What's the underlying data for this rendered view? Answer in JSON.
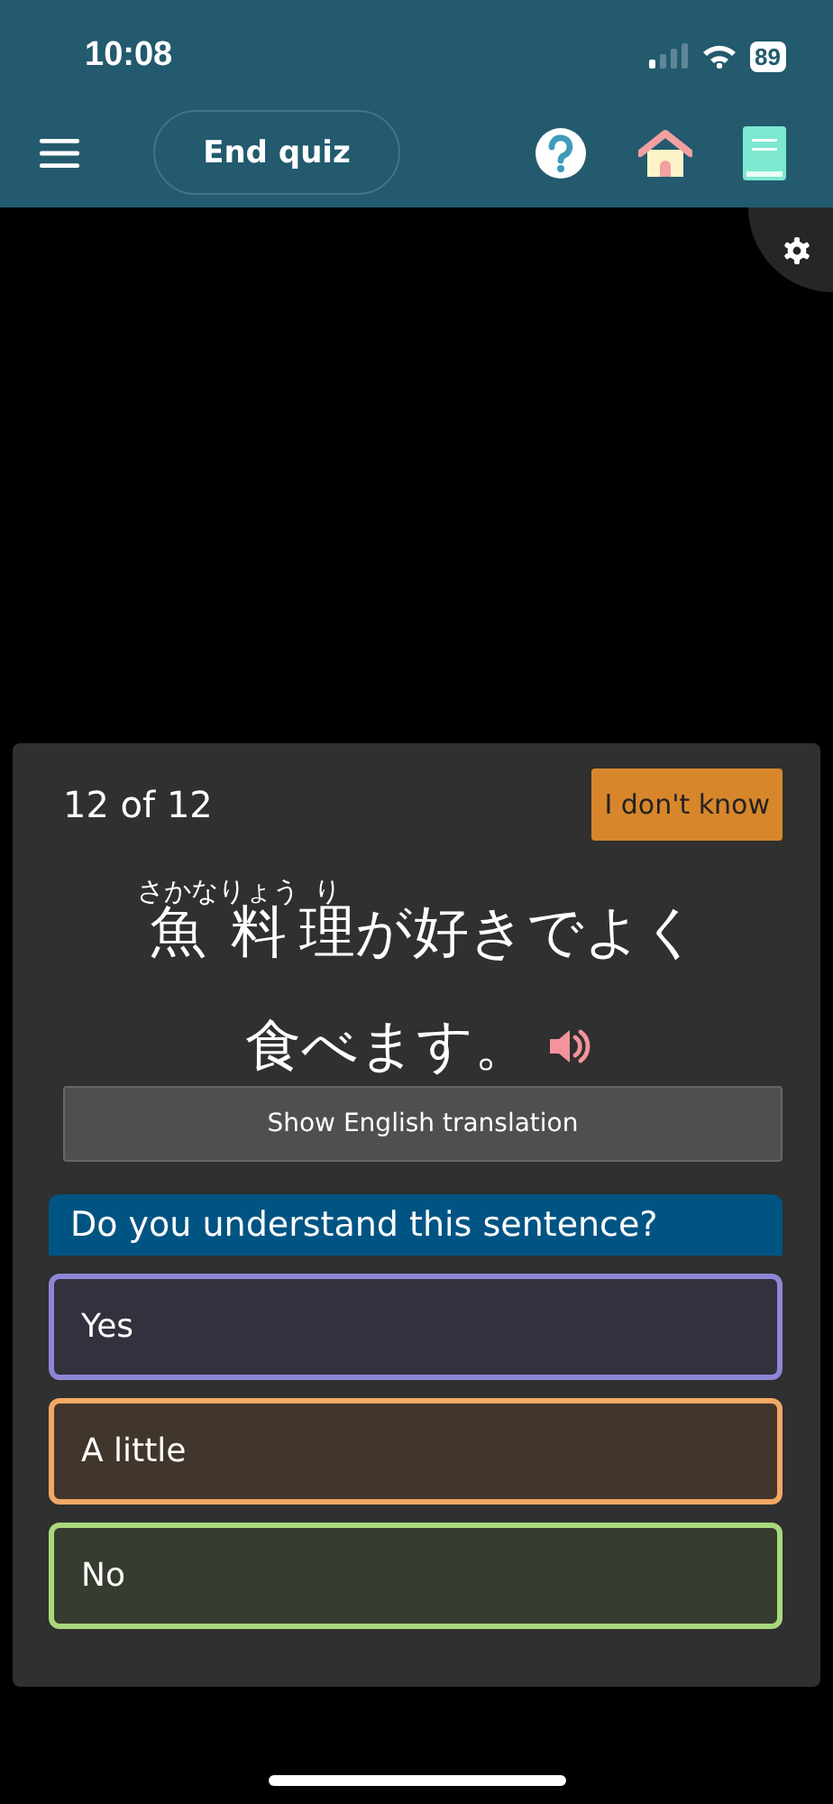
{
  "status_bar": {
    "time": "10:08",
    "battery": "89"
  },
  "toolbar": {
    "end_button": "End quiz"
  },
  "card": {
    "progress": "12 of 12",
    "dont_know_button": "I don't know",
    "sentence_lines": [
      [
        {
          "base": "魚",
          "reading": "さかな"
        },
        {
          "base": "料",
          "reading": "りょう"
        },
        {
          "base": "理",
          "reading": "り"
        },
        {
          "base": "が好きでよく"
        }
      ],
      [
        {
          "base": "食べます。"
        }
      ]
    ],
    "translation_button": "Show English translation",
    "question": "Do you understand this sentence?",
    "answers": [
      {
        "label": "Yes",
        "color": "#8e86d6"
      },
      {
        "label": "A little",
        "color": "#f3a865"
      },
      {
        "label": "No",
        "color": "#a8d87c"
      }
    ]
  }
}
